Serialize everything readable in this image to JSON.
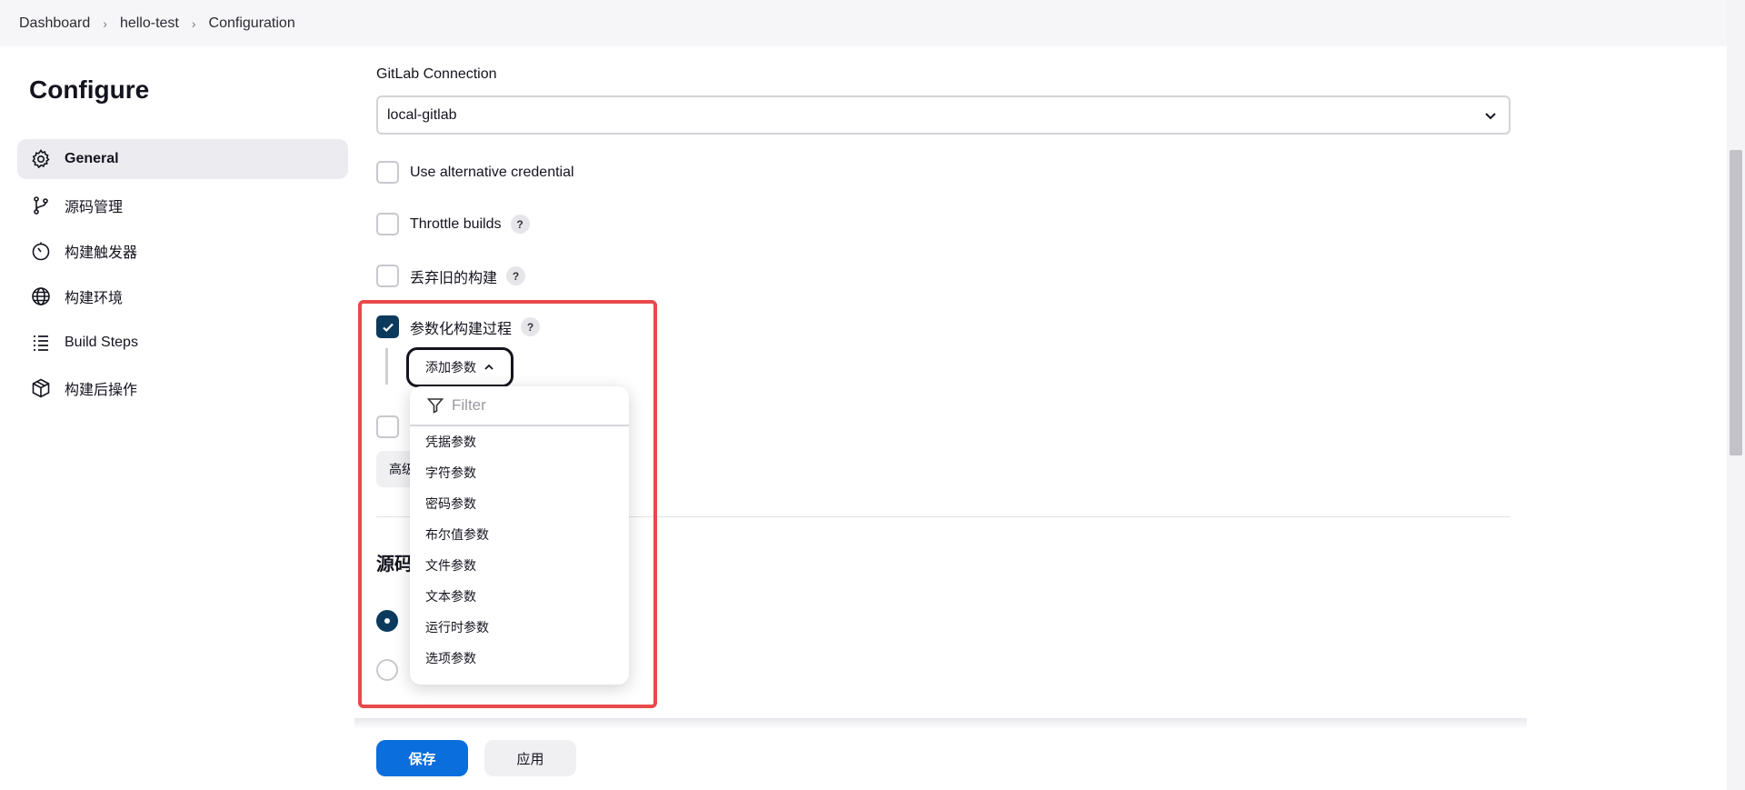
{
  "breadcrumb": {
    "items": [
      "Dashboard",
      "hello-test",
      "Configuration"
    ]
  },
  "sidebar": {
    "title": "Configure",
    "items": [
      {
        "label": "General",
        "icon": "gear-icon",
        "active": true
      },
      {
        "label": "源码管理",
        "icon": "branch-icon",
        "active": false
      },
      {
        "label": "构建触发器",
        "icon": "clock-icon",
        "active": false
      },
      {
        "label": "构建环境",
        "icon": "globe-icon",
        "active": false
      },
      {
        "label": "Build Steps",
        "icon": "list-icon",
        "active": false
      },
      {
        "label": "构建后操作",
        "icon": "cube-icon",
        "active": false
      }
    ]
  },
  "main": {
    "gitlab_label": "GitLab Connection",
    "gitlab_value": "local-gitlab",
    "checkboxes": [
      {
        "label": "Use alternative credential",
        "checked": false,
        "help": false
      },
      {
        "label": "Throttle builds",
        "checked": false,
        "help": true
      },
      {
        "label": "丢弃旧的构建",
        "checked": false,
        "help": true
      },
      {
        "label": "参数化构建过程",
        "checked": true,
        "help": true
      }
    ],
    "help_glyph": "?",
    "add_param_label": "添加参数",
    "advanced_label": "高级",
    "section_title": "源码"
  },
  "dropdown": {
    "filter_placeholder": "Filter",
    "options": [
      "凭据参数",
      "字符参数",
      "密码参数",
      "布尔值参数",
      "文件参数",
      "文本参数",
      "运行时参数",
      "选项参数"
    ]
  },
  "footer": {
    "save_label": "保存",
    "apply_label": "应用"
  },
  "colors": {
    "accent": "#0a6edc",
    "checked": "#0b3a5c",
    "highlight": "#e8494a"
  }
}
